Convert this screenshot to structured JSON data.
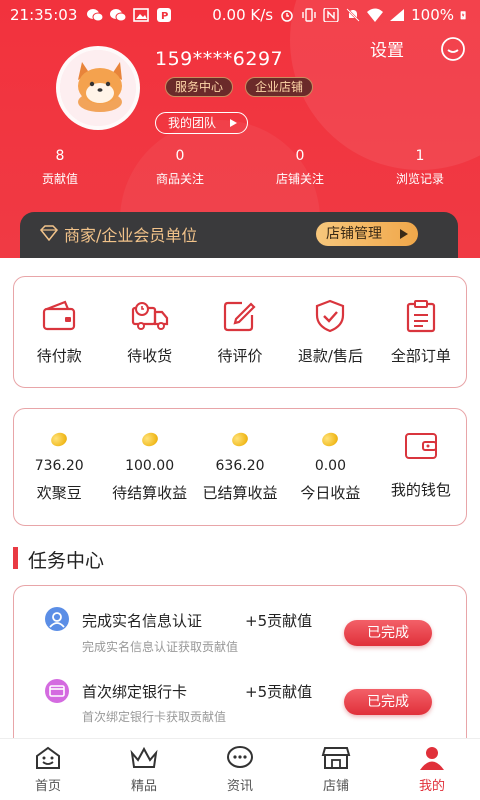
{
  "status_bar": {
    "time": "21:35:03",
    "network_speed": "0.00 K/s",
    "battery": "100%"
  },
  "profile": {
    "phone": "159****6297",
    "service_center": "服务中心",
    "enterprise_shop": "企业店铺",
    "my_team": "我的团队",
    "settings": "设置"
  },
  "stats": [
    {
      "value": "8",
      "label": "贡献值"
    },
    {
      "value": "0",
      "label": "商品关注"
    },
    {
      "value": "0",
      "label": "店铺关注"
    },
    {
      "value": "1",
      "label": "浏览记录"
    }
  ],
  "vip": {
    "text": "商家/企业会员单位",
    "button": "店铺管理"
  },
  "orders": [
    {
      "label": "待付款",
      "icon": "wallet-icon"
    },
    {
      "label": "待收货",
      "icon": "truck-icon"
    },
    {
      "label": "待评价",
      "icon": "edit-icon"
    },
    {
      "label": "退款/售后",
      "icon": "shield-check-icon"
    },
    {
      "label": "全部订单",
      "icon": "clipboard-icon"
    }
  ],
  "wallet": [
    {
      "value": "736.20",
      "label": "欢聚豆"
    },
    {
      "value": "100.00",
      "label": "待结算收益"
    },
    {
      "value": "636.20",
      "label": "已结算收益"
    },
    {
      "value": "0.00",
      "label": "今日收益"
    },
    {
      "value": "",
      "label": "我的钱包"
    }
  ],
  "task_center": {
    "title": "任务中心",
    "tasks": [
      {
        "title": "完成实名信息认证",
        "reward": "+5贡献值",
        "desc": "完成实名信息认证获取贡献值",
        "button": "已完成"
      },
      {
        "title": "首次绑定银行卡",
        "reward": "+5贡献值",
        "desc": "首次绑定银行卡获取贡献值",
        "button": "已完成"
      }
    ]
  },
  "tabs": [
    {
      "label": "首页",
      "icon": "home-icon"
    },
    {
      "label": "精品",
      "icon": "crown-icon"
    },
    {
      "label": "资讯",
      "icon": "message-icon"
    },
    {
      "label": "店铺",
      "icon": "store-icon"
    },
    {
      "label": "我的",
      "icon": "person-icon",
      "active": true
    }
  ],
  "colors": {
    "brand_red": "#f2323d",
    "gold": "#f0a74a",
    "dark_bar": "#3a3a3c"
  }
}
